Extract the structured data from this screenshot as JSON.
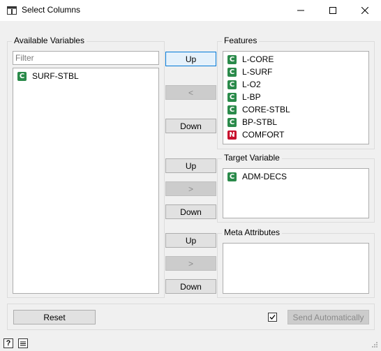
{
  "window": {
    "title": "Select Columns"
  },
  "available": {
    "group_label": "Available Variables",
    "filter_placeholder": "Filter",
    "items": [
      {
        "badge": "C",
        "label": "SURF-STBL"
      }
    ]
  },
  "features": {
    "group_label": "Features",
    "items": [
      {
        "badge": "C",
        "label": "L-CORE"
      },
      {
        "badge": "C",
        "label": "L-SURF"
      },
      {
        "badge": "C",
        "label": "L-O2"
      },
      {
        "badge": "C",
        "label": "L-BP"
      },
      {
        "badge": "C",
        "label": "CORE-STBL"
      },
      {
        "badge": "C",
        "label": "BP-STBL"
      },
      {
        "badge": "N",
        "label": "COMFORT"
      }
    ]
  },
  "target": {
    "group_label": "Target Variable",
    "items": [
      {
        "badge": "C",
        "label": "ADM-DECS"
      }
    ]
  },
  "meta": {
    "group_label": "Meta Attributes",
    "items": []
  },
  "buttons": {
    "up": "Up",
    "down": "Down",
    "move_left": "<",
    "move_right": ">",
    "reset": "Reset",
    "send_auto": "Send Automatically"
  },
  "send_auto_checked": true,
  "colors": {
    "badge_c": "#2a8a4a",
    "badge_n": "#c8102e",
    "focus": "#0078d7"
  }
}
